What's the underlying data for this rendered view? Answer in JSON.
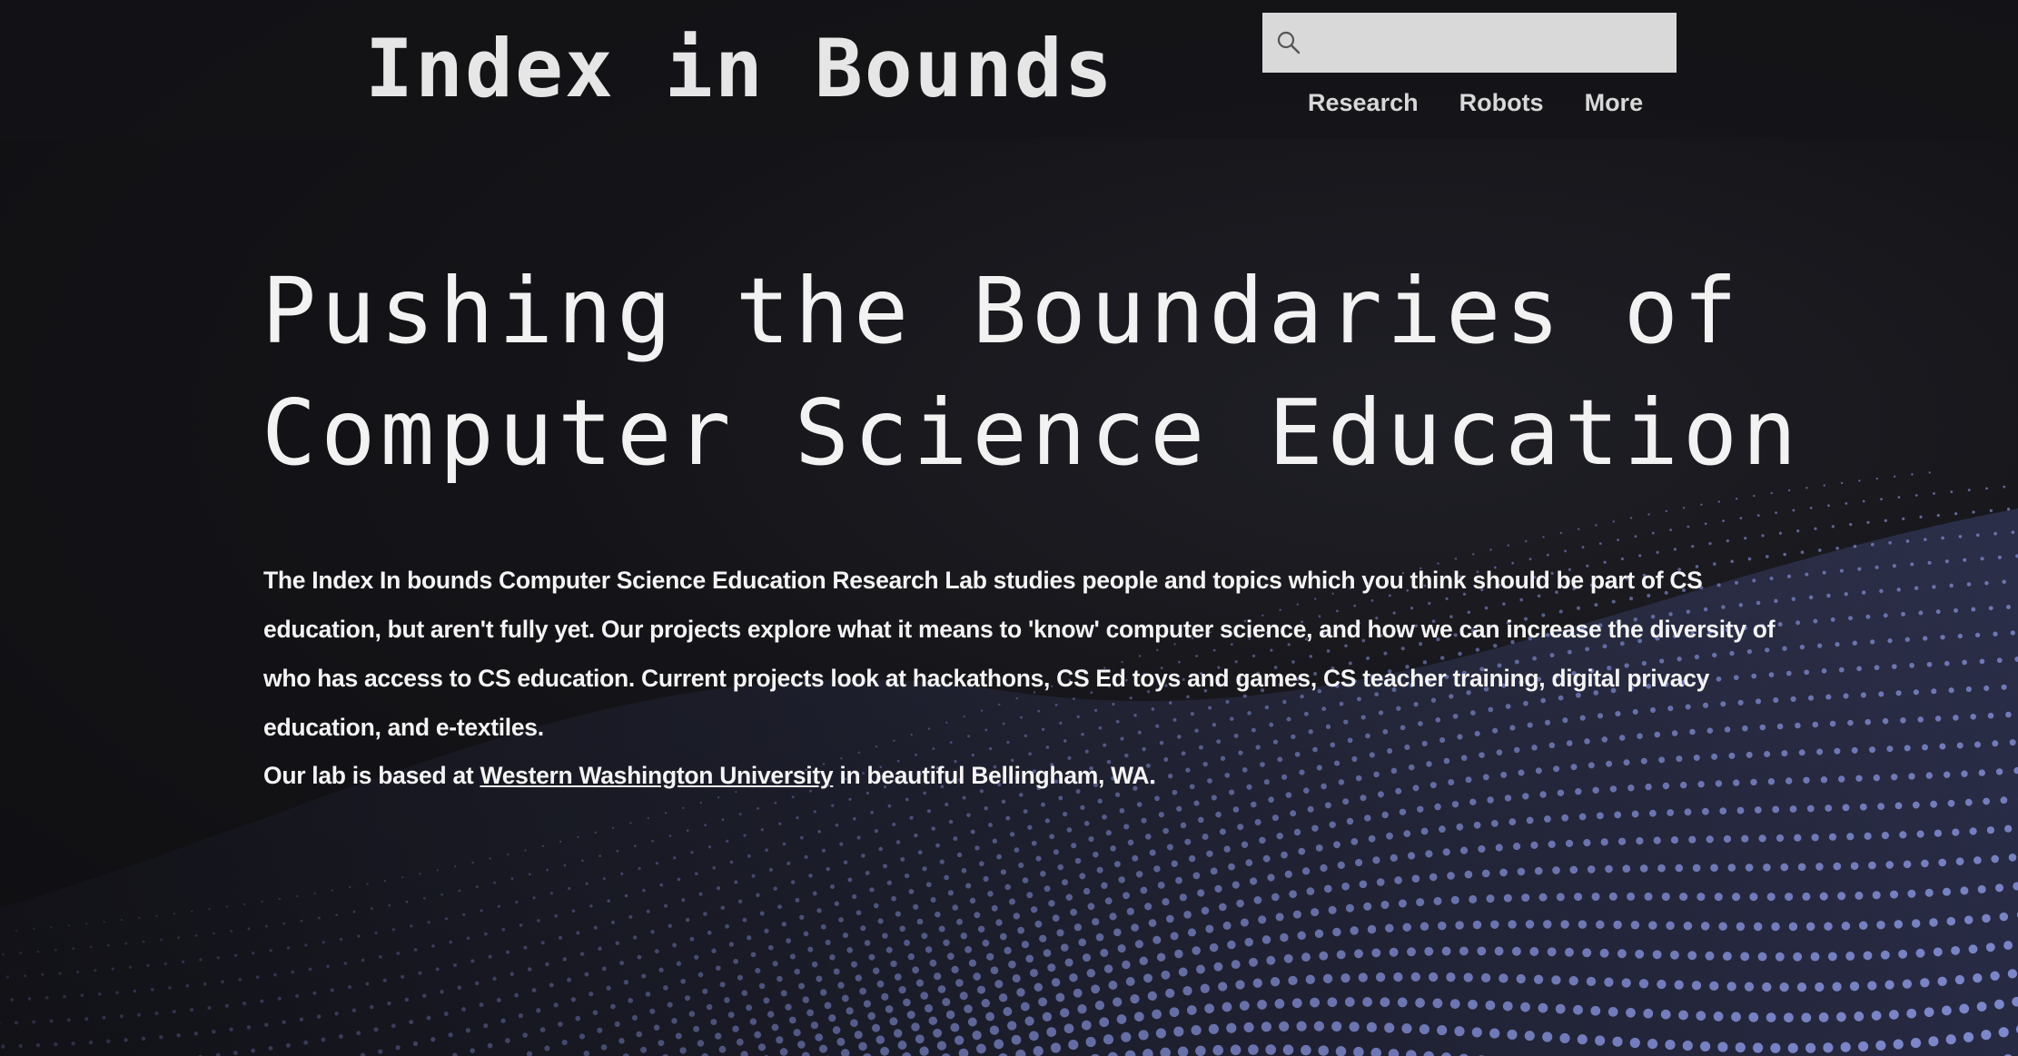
{
  "header": {
    "site_title": "Index in Bounds",
    "search": {
      "placeholder": "",
      "value": "",
      "icon": "search-icon"
    },
    "nav": [
      {
        "label": "Research"
      },
      {
        "label": "Robots"
      },
      {
        "label": "More"
      }
    ]
  },
  "hero": {
    "title_line1": "Pushing the Boundaries of",
    "title_line2": "Computer Science Education",
    "intro": "The Index In bounds Computer Science Education Research Lab studies people and topics which you think should be part of CS education, but aren't fully yet. Our projects explore what it means to 'know' computer science, and how we can increase the diversity of who has access to CS education. Current projects look at hackathons, CS Ed toys and games, CS teacher training,  digital privacy education, and e-textiles.",
    "location_prefix": "Our lab is based at ",
    "location_link": "Western Washington University",
    "location_suffix": " in beautiful Bellingham, WA."
  },
  "theme": {
    "background": "#121216",
    "dot_color": "#8a96e0",
    "text_color": "#f4f4f4",
    "search_bg": "#d9d9d9"
  }
}
